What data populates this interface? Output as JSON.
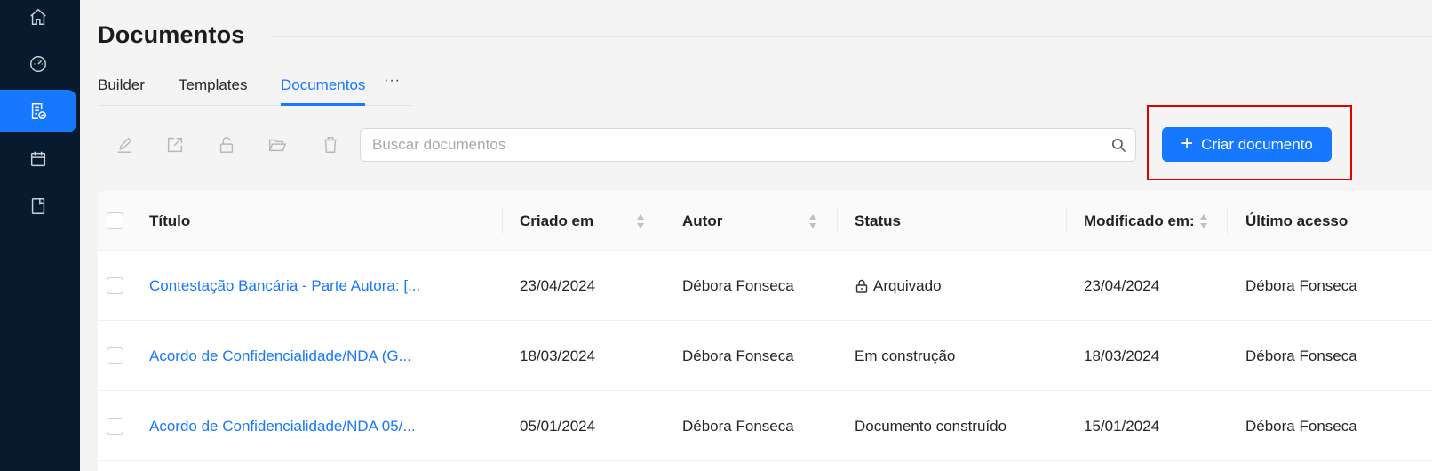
{
  "sidebar": {
    "items": [
      {
        "icon": "home-icon"
      },
      {
        "icon": "dashboard-icon"
      },
      {
        "icon": "document-check-icon",
        "active": true
      },
      {
        "icon": "calendar-icon"
      },
      {
        "icon": "book-icon"
      }
    ]
  },
  "page": {
    "title": "Documentos"
  },
  "tabs": [
    {
      "label": "Builder"
    },
    {
      "label": "Templates"
    },
    {
      "label": "Documentos",
      "active": true
    }
  ],
  "tabs_more": "···",
  "toolbar": {
    "icons": [
      "edit-icon",
      "export-icon",
      "unlock-icon",
      "folder-open-icon",
      "trash-icon"
    ]
  },
  "search": {
    "placeholder": "Buscar documentos",
    "value": ""
  },
  "create_button": {
    "label": "Criar documento"
  },
  "table": {
    "columns": [
      "Título",
      "Criado em",
      "Autor",
      "Status",
      "Modificado em:",
      "Último acesso"
    ],
    "rows": [
      {
        "title": "Contestação Bancária - Parte Autora: [...",
        "created": "23/04/2024",
        "author": "Débora Fonseca",
        "status": "Arquivado",
        "status_locked": true,
        "modified": "23/04/2024",
        "last_access": "Débora Fonseca"
      },
      {
        "title": "Acordo de Confidencialidade/NDA (G...",
        "created": "18/03/2024",
        "author": "Débora Fonseca",
        "status": "Em construção",
        "status_locked": false,
        "modified": "18/03/2024",
        "last_access": "Débora Fonseca"
      },
      {
        "title": "Acordo de Confidencialidade/NDA 05/...",
        "created": "05/01/2024",
        "author": "Débora Fonseca",
        "status": "Documento construído",
        "status_locked": false,
        "modified": "15/01/2024",
        "last_access": "Débora Fonseca"
      }
    ]
  },
  "colors": {
    "accent": "#1677ff",
    "sidebar": "#071a2e",
    "highlight": "#e00000"
  }
}
